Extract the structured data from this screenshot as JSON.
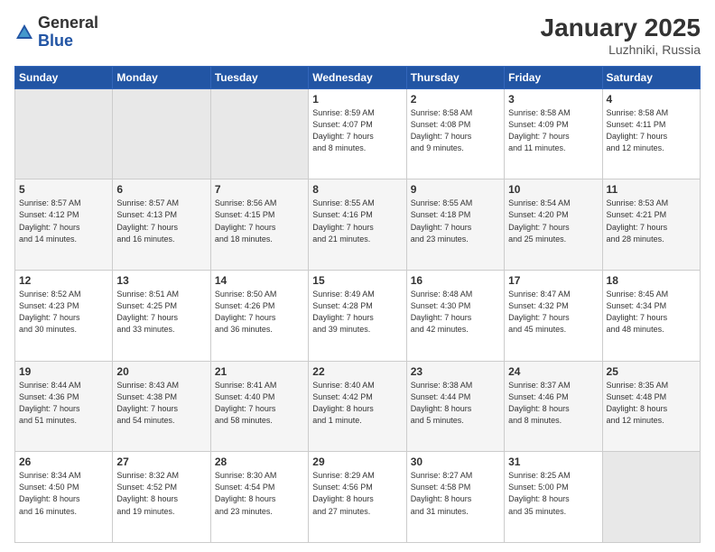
{
  "header": {
    "logo_general": "General",
    "logo_blue": "Blue",
    "month_title": "January 2025",
    "location": "Luzhniki, Russia"
  },
  "weekdays": [
    "Sunday",
    "Monday",
    "Tuesday",
    "Wednesday",
    "Thursday",
    "Friday",
    "Saturday"
  ],
  "weeks": [
    [
      {
        "day": "",
        "info": ""
      },
      {
        "day": "",
        "info": ""
      },
      {
        "day": "",
        "info": ""
      },
      {
        "day": "1",
        "info": "Sunrise: 8:59 AM\nSunset: 4:07 PM\nDaylight: 7 hours\nand 8 minutes."
      },
      {
        "day": "2",
        "info": "Sunrise: 8:58 AM\nSunset: 4:08 PM\nDaylight: 7 hours\nand 9 minutes."
      },
      {
        "day": "3",
        "info": "Sunrise: 8:58 AM\nSunset: 4:09 PM\nDaylight: 7 hours\nand 11 minutes."
      },
      {
        "day": "4",
        "info": "Sunrise: 8:58 AM\nSunset: 4:11 PM\nDaylight: 7 hours\nand 12 minutes."
      }
    ],
    [
      {
        "day": "5",
        "info": "Sunrise: 8:57 AM\nSunset: 4:12 PM\nDaylight: 7 hours\nand 14 minutes."
      },
      {
        "day": "6",
        "info": "Sunrise: 8:57 AM\nSunset: 4:13 PM\nDaylight: 7 hours\nand 16 minutes."
      },
      {
        "day": "7",
        "info": "Sunrise: 8:56 AM\nSunset: 4:15 PM\nDaylight: 7 hours\nand 18 minutes."
      },
      {
        "day": "8",
        "info": "Sunrise: 8:55 AM\nSunset: 4:16 PM\nDaylight: 7 hours\nand 21 minutes."
      },
      {
        "day": "9",
        "info": "Sunrise: 8:55 AM\nSunset: 4:18 PM\nDaylight: 7 hours\nand 23 minutes."
      },
      {
        "day": "10",
        "info": "Sunrise: 8:54 AM\nSunset: 4:20 PM\nDaylight: 7 hours\nand 25 minutes."
      },
      {
        "day": "11",
        "info": "Sunrise: 8:53 AM\nSunset: 4:21 PM\nDaylight: 7 hours\nand 28 minutes."
      }
    ],
    [
      {
        "day": "12",
        "info": "Sunrise: 8:52 AM\nSunset: 4:23 PM\nDaylight: 7 hours\nand 30 minutes."
      },
      {
        "day": "13",
        "info": "Sunrise: 8:51 AM\nSunset: 4:25 PM\nDaylight: 7 hours\nand 33 minutes."
      },
      {
        "day": "14",
        "info": "Sunrise: 8:50 AM\nSunset: 4:26 PM\nDaylight: 7 hours\nand 36 minutes."
      },
      {
        "day": "15",
        "info": "Sunrise: 8:49 AM\nSunset: 4:28 PM\nDaylight: 7 hours\nand 39 minutes."
      },
      {
        "day": "16",
        "info": "Sunrise: 8:48 AM\nSunset: 4:30 PM\nDaylight: 7 hours\nand 42 minutes."
      },
      {
        "day": "17",
        "info": "Sunrise: 8:47 AM\nSunset: 4:32 PM\nDaylight: 7 hours\nand 45 minutes."
      },
      {
        "day": "18",
        "info": "Sunrise: 8:45 AM\nSunset: 4:34 PM\nDaylight: 7 hours\nand 48 minutes."
      }
    ],
    [
      {
        "day": "19",
        "info": "Sunrise: 8:44 AM\nSunset: 4:36 PM\nDaylight: 7 hours\nand 51 minutes."
      },
      {
        "day": "20",
        "info": "Sunrise: 8:43 AM\nSunset: 4:38 PM\nDaylight: 7 hours\nand 54 minutes."
      },
      {
        "day": "21",
        "info": "Sunrise: 8:41 AM\nSunset: 4:40 PM\nDaylight: 7 hours\nand 58 minutes."
      },
      {
        "day": "22",
        "info": "Sunrise: 8:40 AM\nSunset: 4:42 PM\nDaylight: 8 hours\nand 1 minute."
      },
      {
        "day": "23",
        "info": "Sunrise: 8:38 AM\nSunset: 4:44 PM\nDaylight: 8 hours\nand 5 minutes."
      },
      {
        "day": "24",
        "info": "Sunrise: 8:37 AM\nSunset: 4:46 PM\nDaylight: 8 hours\nand 8 minutes."
      },
      {
        "day": "25",
        "info": "Sunrise: 8:35 AM\nSunset: 4:48 PM\nDaylight: 8 hours\nand 12 minutes."
      }
    ],
    [
      {
        "day": "26",
        "info": "Sunrise: 8:34 AM\nSunset: 4:50 PM\nDaylight: 8 hours\nand 16 minutes."
      },
      {
        "day": "27",
        "info": "Sunrise: 8:32 AM\nSunset: 4:52 PM\nDaylight: 8 hours\nand 19 minutes."
      },
      {
        "day": "28",
        "info": "Sunrise: 8:30 AM\nSunset: 4:54 PM\nDaylight: 8 hours\nand 23 minutes."
      },
      {
        "day": "29",
        "info": "Sunrise: 8:29 AM\nSunset: 4:56 PM\nDaylight: 8 hours\nand 27 minutes."
      },
      {
        "day": "30",
        "info": "Sunrise: 8:27 AM\nSunset: 4:58 PM\nDaylight: 8 hours\nand 31 minutes."
      },
      {
        "day": "31",
        "info": "Sunrise: 8:25 AM\nSunset: 5:00 PM\nDaylight: 8 hours\nand 35 minutes."
      },
      {
        "day": "",
        "info": ""
      }
    ]
  ]
}
